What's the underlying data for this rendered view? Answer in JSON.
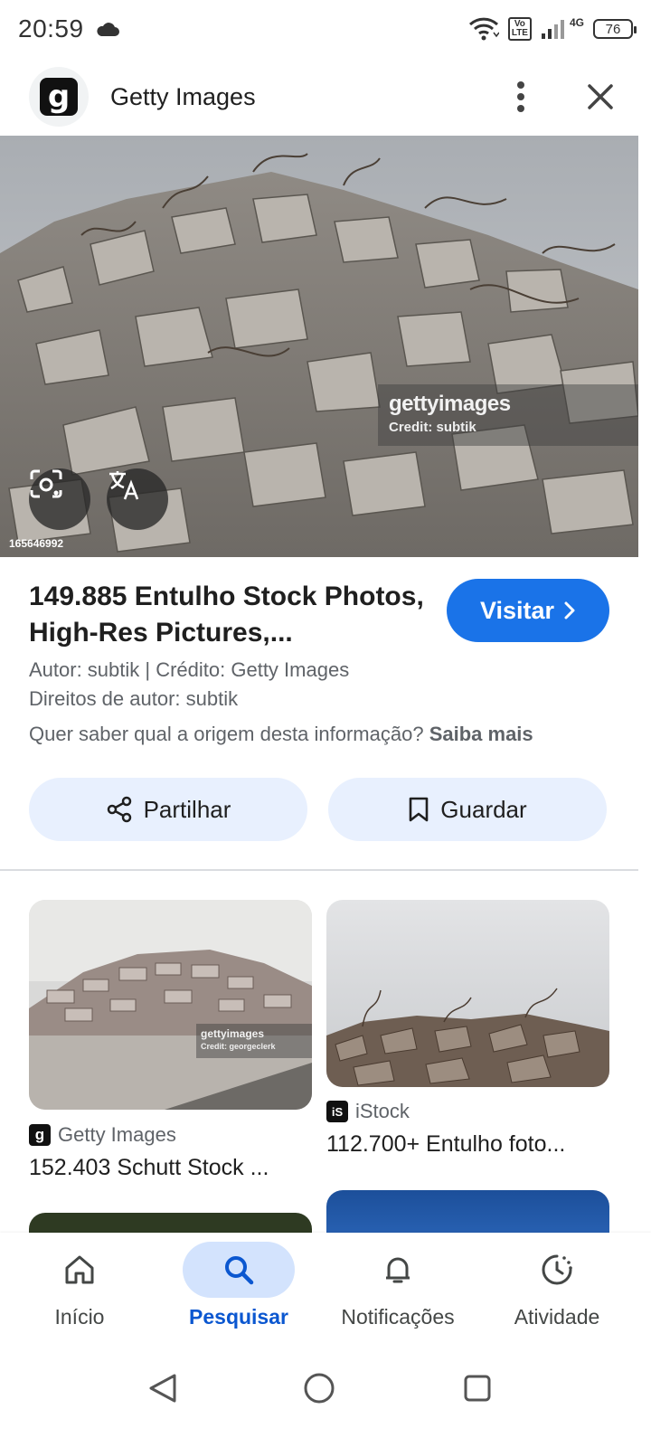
{
  "status_bar": {
    "time": "20:59",
    "battery": "76",
    "volte": "Vo\nLTE",
    "network": "4G"
  },
  "header": {
    "logo_letter": "g",
    "title": "Getty Images"
  },
  "main_image": {
    "watermark_brand": "gettyimages",
    "watermark_credit": "Credit: subtik",
    "image_id": "165646992"
  },
  "result": {
    "title": "149.885 Entulho Stock Photos, High-Res Pictures,...",
    "visit_label": "Visitar",
    "author_line": "Autor: subtik | Crédito: Getty Images",
    "copyright_line": "Direitos de autor: subtik",
    "origin_question": "Quer saber qual a origem desta informação?",
    "learn_more": "Saiba mais"
  },
  "actions": {
    "share_label": "Partilhar",
    "save_label": "Guardar"
  },
  "related": [
    {
      "source": "Getty Images",
      "source_icon": "g",
      "title": "152.403 Schutt Stock ...",
      "watermark_brand": "gettyimages",
      "watermark_credit": "Credit: georgeclerk"
    },
    {
      "source": "iStock",
      "source_icon": "iS",
      "title": "112.700+ Entulho foto..."
    }
  ],
  "bottom_nav": [
    {
      "label": "Início",
      "icon": "home-icon",
      "active": false
    },
    {
      "label": "Pesquisar",
      "icon": "search-icon",
      "active": true
    },
    {
      "label": "Notificações",
      "icon": "bell-icon",
      "active": false
    },
    {
      "label": "Atividade",
      "icon": "activity-icon",
      "active": false
    }
  ],
  "colors": {
    "accent": "#1a73e8",
    "active_nav": "#0b57d0",
    "pill": "#e8f0fe"
  }
}
